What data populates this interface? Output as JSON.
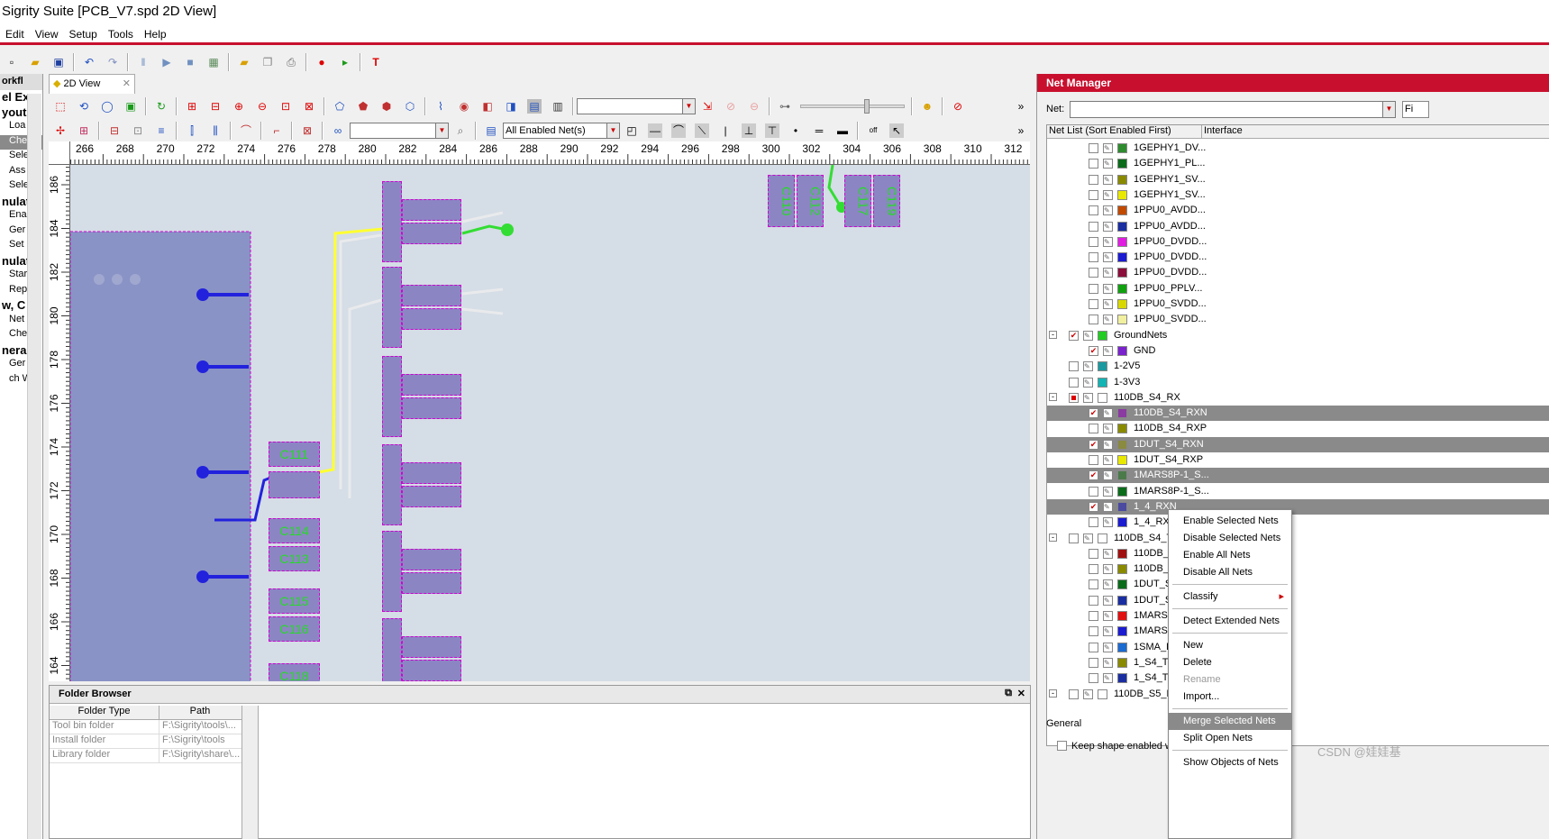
{
  "window_title": "Sigrity Suite [PCB_V7.spd 2D View]",
  "menu": [
    "Edit",
    "View",
    "Setup",
    "Tools",
    "Help"
  ],
  "left_panel": {
    "title": "orkfl",
    "items": [
      "el Ex",
      "yout",
      "Loa",
      "Che",
      "Sele",
      "Ass",
      "Sele",
      "nulat",
      "Ena",
      "Ger",
      "Set",
      "nulat",
      "Star",
      "Rep",
      "w, C",
      "Net",
      "Che",
      "nera",
      "Ger",
      "ch Wo"
    ]
  },
  "doc_tab": {
    "label": "2D View"
  },
  "toolbar": {
    "net_filter": "All Enabled Net(s)",
    "layer_combo": "",
    "search_combo": ""
  },
  "ruler_h": [
    "266",
    "268",
    "270",
    "272",
    "274",
    "276",
    "278",
    "280",
    "282",
    "284",
    "286",
    "288",
    "290",
    "292",
    "294",
    "296",
    "298",
    "300",
    "302",
    "304",
    "306",
    "308",
    "310",
    "312"
  ],
  "ruler_v": [
    "186",
    "184",
    "182",
    "180",
    "178",
    "176",
    "174",
    "172",
    "170",
    "168",
    "166",
    "164",
    "162"
  ],
  "canvas": {
    "pads": [
      "C111",
      "C114",
      "C113",
      "C115",
      "C116",
      "C118",
      "C110",
      "C112",
      "C117",
      "C119",
      "C120",
      "C121"
    ],
    "colors": {
      "bg": "#d5dde6",
      "pad": "#8c85c4",
      "yellow": "#ffff33",
      "green": "#33dd33",
      "blue": "#2222dd"
    }
  },
  "folder_browser": {
    "title": "Folder Browser",
    "columns": [
      "Folder Type",
      "Path"
    ],
    "rows": [
      [
        "Tool bin folder",
        "F:\\Sigrity\\tools\\..."
      ],
      [
        "Install folder",
        "F:\\Sigrity\\tools"
      ],
      [
        "Library folder",
        "F:\\Sigrity\\share\\..."
      ]
    ]
  },
  "net_manager": {
    "title": "Net Manager",
    "net_label": "Net:",
    "find_label": "Fi",
    "net_input": "",
    "columns": [
      "Net List (Sort Enabled First)",
      "Interface"
    ],
    "rows": [
      {
        "label": "1GEPHY1_DV...",
        "color": "#2e8b2e",
        "checked": false,
        "indent": 2,
        "sel": false
      },
      {
        "label": "1GEPHY1_PL...",
        "color": "#0b6b1b",
        "checked": false,
        "indent": 2,
        "sel": false
      },
      {
        "label": "1GEPHY1_SV...",
        "color": "#8a8a00",
        "checked": false,
        "indent": 2,
        "sel": false
      },
      {
        "label": "1GEPHY1_SV...",
        "color": "#e8e800",
        "checked": false,
        "indent": 2,
        "sel": false
      },
      {
        "label": "1PPU0_AVDD...",
        "color": "#c04a00",
        "checked": false,
        "indent": 2,
        "sel": false
      },
      {
        "label": "1PPU0_AVDD...",
        "color": "#1a2ea0",
        "checked": false,
        "indent": 2,
        "sel": false
      },
      {
        "label": "1PPU0_DVDD...",
        "color": "#e01ee0",
        "checked": false,
        "indent": 2,
        "sel": false
      },
      {
        "label": "1PPU0_DVDD...",
        "color": "#1b1bd0",
        "checked": false,
        "indent": 2,
        "sel": false
      },
      {
        "label": "1PPU0_DVDD...",
        "color": "#8b0f3a",
        "checked": false,
        "indent": 2,
        "sel": false
      },
      {
        "label": "1PPU0_PPLV...",
        "color": "#10a010",
        "checked": false,
        "indent": 2,
        "sel": false
      },
      {
        "label": "1PPU0_SVDD...",
        "color": "#d8d800",
        "checked": false,
        "indent": 2,
        "sel": false
      },
      {
        "label": "1PPU0_SVDD...",
        "color": "#f0f0a0",
        "checked": false,
        "indent": 2,
        "sel": false
      },
      {
        "label": "GroundNets",
        "color": "#22cc22",
        "checked": true,
        "indent": 1,
        "sel": false,
        "group": true
      },
      {
        "label": "GND",
        "color": "#7a22cc",
        "checked": true,
        "indent": 2,
        "sel": false
      },
      {
        "label": "1-2V5",
        "color": "#1a9aa0",
        "checked": false,
        "indent": 1,
        "sel": false
      },
      {
        "label": "1-3V3",
        "color": "#12b4b4",
        "checked": false,
        "indent": 1,
        "sel": false
      },
      {
        "label": "110DB_S4_RX",
        "color": "#ffffff",
        "checked": "partial",
        "indent": 1,
        "sel": false,
        "group": true
      },
      {
        "label": "110DB_S4_RXN",
        "color": "#8a3aa0",
        "checked": true,
        "indent": 2,
        "sel": true
      },
      {
        "label": "110DB_S4_RXP",
        "color": "#8a8a00",
        "checked": false,
        "indent": 2,
        "sel": false
      },
      {
        "label": "1DUT_S4_RXN",
        "color": "#8a8a40",
        "checked": true,
        "indent": 2,
        "sel": true
      },
      {
        "label": "1DUT_S4_RXP",
        "color": "#e8e800",
        "checked": false,
        "indent": 2,
        "sel": false
      },
      {
        "label": "1MARS8P-1_S...",
        "color": "#4a7a4a",
        "checked": true,
        "indent": 2,
        "sel": true
      },
      {
        "label": "1MARS8P-1_S...",
        "color": "#0b6b1b",
        "checked": false,
        "indent": 2,
        "sel": false
      },
      {
        "label": "1_4_RXN",
        "color": "#4a4aa0",
        "checked": true,
        "indent": 2,
        "sel": true
      },
      {
        "label": "1_4_RXP",
        "color": "#1b1bd0",
        "checked": false,
        "indent": 2,
        "sel": false
      },
      {
        "label": "110DB_S4_TX",
        "color": "#ffffff",
        "checked": false,
        "indent": 1,
        "sel": false,
        "group": true
      },
      {
        "label": "110DB_...",
        "color": "#a01010",
        "checked": false,
        "indent": 2,
        "sel": false
      },
      {
        "label": "110DB_...",
        "color": "#8a8a00",
        "checked": false,
        "indent": 2,
        "sel": false
      },
      {
        "label": "1DUT_S...",
        "color": "#0b6b1b",
        "checked": false,
        "indent": 2,
        "sel": false
      },
      {
        "label": "1DUT_S...",
        "color": "#1a2ea0",
        "checked": false,
        "indent": 2,
        "sel": false
      },
      {
        "label": "1MARS...",
        "color": "#e01010",
        "checked": false,
        "indent": 2,
        "sel": false
      },
      {
        "label": "1MARS...",
        "color": "#1b1bd0",
        "checked": false,
        "indent": 2,
        "sel": false
      },
      {
        "label": "1SMA_D...",
        "color": "#1b6bd0",
        "checked": false,
        "indent": 2,
        "sel": false
      },
      {
        "label": "1_S4_TX...",
        "color": "#8a8a00",
        "checked": false,
        "indent": 2,
        "sel": false
      },
      {
        "label": "1_S4_TX...",
        "color": "#1a2ea0",
        "checked": false,
        "indent": 2,
        "sel": false
      },
      {
        "label": "110DB_S5_R...",
        "color": "#ffffff",
        "checked": false,
        "indent": 1,
        "sel": false,
        "group": true
      }
    ],
    "general_label": "General",
    "keep_shape_label": "Keep shape enabled w..."
  },
  "context_menu": [
    {
      "label": "Enable Selected Nets"
    },
    {
      "label": "Disable Selected Nets"
    },
    {
      "label": "Enable All Nets"
    },
    {
      "label": "Disable All Nets",
      "sep_after": true
    },
    {
      "label": "Classify",
      "submenu": true,
      "sep_after": true
    },
    {
      "label": "Detect Extended Nets",
      "sep_after": true
    },
    {
      "label": "New"
    },
    {
      "label": "Delete"
    },
    {
      "label": "Rename",
      "disabled": true
    },
    {
      "label": "Import...",
      "sep_after": true
    },
    {
      "label": "Merge Selected Nets",
      "highlight": true
    },
    {
      "label": "Split Open Nets",
      "sep_after": true
    },
    {
      "label": "Show Objects of Nets"
    }
  ],
  "watermark": "CSDN @娃娃基"
}
